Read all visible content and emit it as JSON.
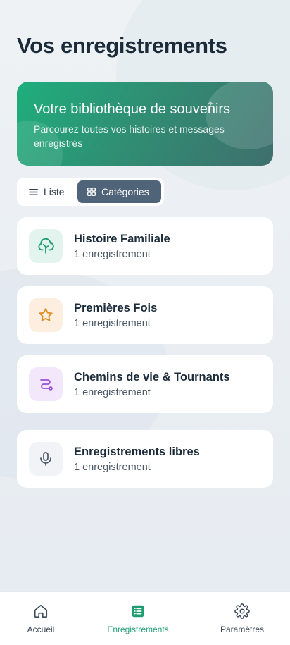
{
  "header": {
    "title": "Vos enregistrements"
  },
  "hero": {
    "title": "Votre bibliothèque de souvenirs",
    "subtitle": "Parcourez toutes vos histoires et messages enregistrés"
  },
  "view_toggle": {
    "list_label": "Liste",
    "categories_label": "Catégories",
    "selected": "Catégories"
  },
  "categories": [
    {
      "title": "Histoire Familiale",
      "count": "1 enregistrement",
      "icon": "tree-icon",
      "color": "#1f9e72",
      "bg": "#e3f4ee"
    },
    {
      "title": "Premières Fois",
      "count": "1 enregistrement",
      "icon": "star-icon",
      "color": "#e08a1e",
      "bg": "#fdeee0"
    },
    {
      "title": "Chemins de vie & Tournants",
      "count": "1 enregistrement",
      "icon": "route-icon",
      "color": "#9b4fd8",
      "bg": "#f3e8fb"
    },
    {
      "title": "Enregistrements libres",
      "count": "1 enregistrement",
      "icon": "microphone-icon",
      "color": "#4b5865",
      "bg": "#f1f3f6"
    }
  ],
  "bottom_nav": {
    "items": [
      {
        "label": "Accueil",
        "icon": "home-icon"
      },
      {
        "label": "Enregistrements",
        "icon": "list-icon",
        "active": true
      },
      {
        "label": "Paramètres",
        "icon": "gear-icon"
      }
    ],
    "active_color": "#1f9e72"
  }
}
